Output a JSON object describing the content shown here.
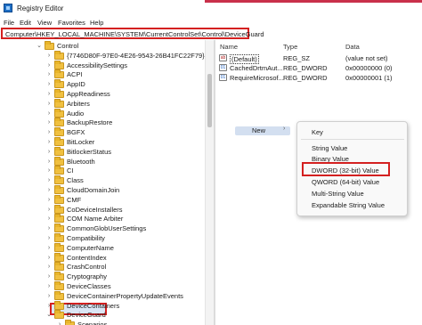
{
  "window": {
    "title": "Registry Editor",
    "accent_color": "#c9304a"
  },
  "menu": [
    "File",
    "Edit",
    "View",
    "Favorites",
    "Help"
  ],
  "address": "Computer\\HKEY_LOCAL_MACHINE\\SYSTEM\\CurrentControlSet\\Control\\DeviceGuard",
  "tree": {
    "items": [
      {
        "label": "Control",
        "chevron": "⌄",
        "depth": 0
      },
      {
        "label": "{7746D80F-97E0-4E26-9543-26B41FC22F79}",
        "chevron": "›",
        "depth": 1
      },
      {
        "label": "AccessibilitySettings",
        "chevron": "›",
        "depth": 1
      },
      {
        "label": "ACPI",
        "chevron": "›",
        "depth": 1
      },
      {
        "label": "AppID",
        "chevron": "›",
        "depth": 1
      },
      {
        "label": "AppReadiness",
        "chevron": "›",
        "depth": 1
      },
      {
        "label": "Arbiters",
        "chevron": "›",
        "depth": 1
      },
      {
        "label": "Audio",
        "chevron": "›",
        "depth": 1
      },
      {
        "label": "BackupRestore",
        "chevron": "›",
        "depth": 1
      },
      {
        "label": "BGFX",
        "chevron": "›",
        "depth": 1
      },
      {
        "label": "BitLocker",
        "chevron": "›",
        "depth": 1
      },
      {
        "label": "BitlockerStatus",
        "chevron": "›",
        "depth": 1
      },
      {
        "label": "Bluetooth",
        "chevron": "›",
        "depth": 1
      },
      {
        "label": "CI",
        "chevron": "›",
        "depth": 1
      },
      {
        "label": "Class",
        "chevron": "›",
        "depth": 1
      },
      {
        "label": "CloudDomainJoin",
        "chevron": "›",
        "depth": 1
      },
      {
        "label": "CMF",
        "chevron": "›",
        "depth": 1
      },
      {
        "label": "CoDeviceInstallers",
        "chevron": "›",
        "depth": 1
      },
      {
        "label": "COM Name Arbiter",
        "chevron": "›",
        "depth": 1
      },
      {
        "label": "CommonGlobUserSettings",
        "chevron": "›",
        "depth": 1
      },
      {
        "label": "Compatibility",
        "chevron": "›",
        "depth": 1
      },
      {
        "label": "ComputerName",
        "chevron": "›",
        "depth": 1
      },
      {
        "label": "ContentIndex",
        "chevron": "›",
        "depth": 1
      },
      {
        "label": "CrashControl",
        "chevron": "›",
        "depth": 1
      },
      {
        "label": "Cryptography",
        "chevron": "›",
        "depth": 1
      },
      {
        "label": "DeviceClasses",
        "chevron": "›",
        "depth": 1
      },
      {
        "label": "DeviceContainerPropertyUpdateEvents",
        "chevron": "›",
        "depth": 1
      },
      {
        "label": "DeviceContainers",
        "chevron": "›",
        "depth": 1
      },
      {
        "label": "DeviceGuard",
        "chevron": "⌄",
        "depth": 1,
        "selected": true
      },
      {
        "label": "Scenarios",
        "chevron": "›",
        "depth": 2
      }
    ]
  },
  "list": {
    "columns": [
      "Name",
      "Type",
      "Data"
    ],
    "rows": [
      {
        "name": "(Default)",
        "type": "REG_SZ",
        "data": "(value not set)",
        "icon": "ab"
      },
      {
        "name": "CachedDrtmAut...",
        "type": "REG_DWORD",
        "data": "0x00000000 (0)",
        "icon": "bin"
      },
      {
        "name": "RequireMicrosof...",
        "type": "REG_DWORD",
        "data": "0x00000001 (1)",
        "icon": "bin"
      }
    ]
  },
  "context_menu": {
    "new_label": "New",
    "submenu": [
      "Key",
      "String Value",
      "Binary Value",
      "DWORD (32-bit) Value",
      "QWORD (64-bit) Value",
      "Multi-String Value",
      "Expandable String Value"
    ]
  },
  "colors": {
    "highlight_border": "#d42020",
    "selection_bg": "#dbe6f5",
    "folder": "#f0c040"
  }
}
